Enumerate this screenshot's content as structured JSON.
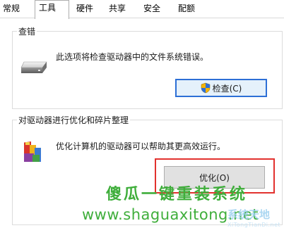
{
  "tabs": [
    {
      "label": "常规",
      "active": false
    },
    {
      "label": "工具",
      "active": true
    },
    {
      "label": "硬件",
      "active": false
    },
    {
      "label": "共享",
      "active": false
    },
    {
      "label": "安全",
      "active": false
    },
    {
      "label": "配额",
      "active": false
    }
  ],
  "check_group": {
    "title": "查错",
    "description": "此选项将检查驱动器中的文件系统错误。",
    "button_label": "检查(C)",
    "icon": "drive-icon"
  },
  "optimize_group": {
    "title": "对驱动器进行优化和碎片整理",
    "description": "优化计算机的驱动器可以帮助其更高效运行。",
    "button_label": "优化(O)",
    "icon": "defrag-icon"
  },
  "watermark": {
    "title": "傻瓜一键重装系统",
    "url": "www.shaguaxitong.net",
    "logo_text": "系统天地",
    "logo_sub": "XiTongTianDi.net"
  },
  "colors": {
    "focus_border": "#2d6fd6",
    "highlight": "#e2312e",
    "watermark": "#3fae3b"
  }
}
